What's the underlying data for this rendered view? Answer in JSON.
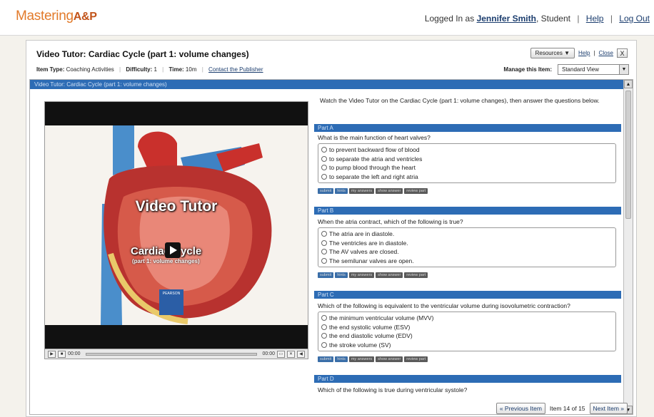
{
  "header": {
    "logo_text": "Mastering",
    "logo_ap": "A&P",
    "logged_in_prefix": "Logged In as",
    "user_name": "Jennifer Smith",
    "user_role": ", Student",
    "help_label": "Help",
    "logout_label": "Log Out"
  },
  "item": {
    "title": "Video Tutor: Cardiac Cycle (part 1: volume changes)",
    "resources_label": "Resources ▼",
    "help_label": "Help",
    "close_label": "Close",
    "close_x": "X",
    "type_label": "Item Type:",
    "type_value": "Coaching Activities",
    "difficulty_label": "Difficulty:",
    "difficulty_value": "1",
    "time_label": "Time:",
    "time_value": "10m",
    "contact_label": "Contact the Publisher",
    "manage_label": "Manage this Item:",
    "manage_value": "Standard View"
  },
  "section_header": "Video Tutor: Cardiac Cycle (part 1: volume changes)",
  "video": {
    "title": "Video Tutor",
    "subtitle": "Cardiac Cycle",
    "subtitle2": "(part 1: volume changes)",
    "publisher": "PEARSON",
    "time_left": "00:00",
    "time_right": "00:00"
  },
  "intro": "Watch the Video Tutor on the Cardiac Cycle (part 1: volume changes), then answer the questions below.",
  "buttons": [
    "submit",
    "hints",
    "my answers",
    "show answer",
    "review part"
  ],
  "parts": [
    {
      "label": "Part A",
      "question": "What is the main function of heart valves?",
      "choices": [
        "to prevent backward flow of blood",
        "to separate the atria and ventricles",
        "to pump blood through the heart",
        "to separate the left and right atria"
      ]
    },
    {
      "label": "Part B",
      "question": "When the atria contract, which of the following is true?",
      "choices": [
        "The atria are in diastole.",
        "The ventricles are in diastole.",
        "The AV valves are closed.",
        "The semilunar valves are open."
      ]
    },
    {
      "label": "Part C",
      "question": "Which of the following is equivalent to the ventricular volume during isovolumetric contraction?",
      "choices": [
        "the minimum ventricular volume (MVV)",
        "the end systolic volume (ESV)",
        "the end diastolic volume (EDV)",
        "the stroke volume (SV)"
      ]
    },
    {
      "label": "Part D",
      "question": "Which of the following is true during ventricular systole?",
      "choices": []
    }
  ],
  "footer": {
    "prev_label": "« Previous Item",
    "position": "Item 14 of 15",
    "next_label": "Next Item »"
  }
}
